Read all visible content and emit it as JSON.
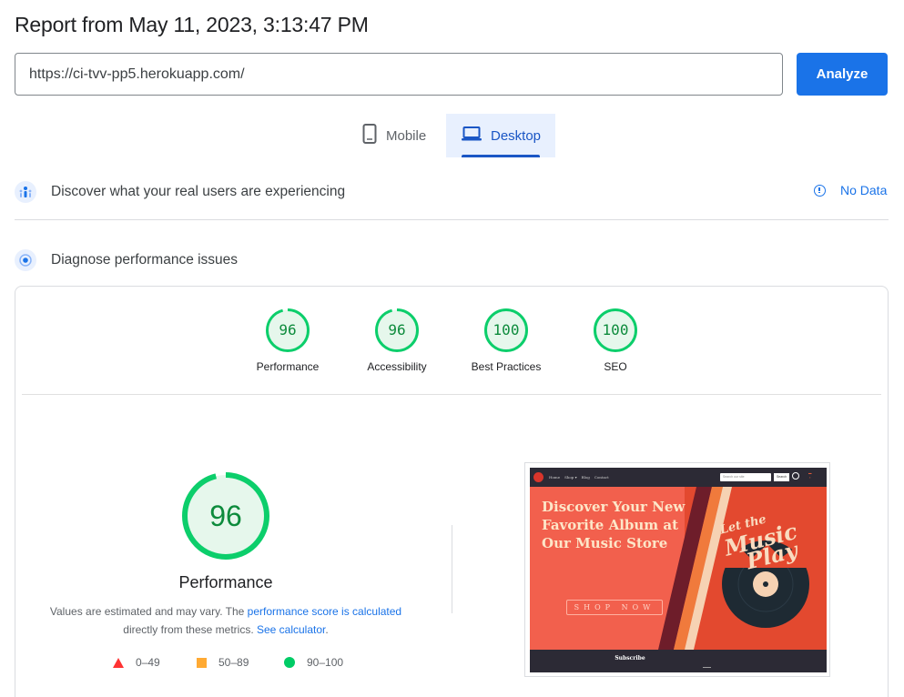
{
  "report": {
    "title": "Report from May 11, 2023, 3:13:47 PM"
  },
  "url_bar": {
    "value": "https://ci-tvv-pp5.herokuapp.com/",
    "button_label": "Analyze"
  },
  "tabs": [
    {
      "label": "Mobile",
      "icon": "smartphone-icon",
      "selected": false
    },
    {
      "label": "Desktop",
      "icon": "laptop-icon",
      "selected": true
    }
  ],
  "real_users": {
    "title": "Discover what your real users are experiencing",
    "status": "No Data"
  },
  "diagnose": {
    "title": "Diagnose performance issues"
  },
  "categories": [
    {
      "label": "Performance",
      "score": "96"
    },
    {
      "label": "Accessibility",
      "score": "96"
    },
    {
      "label": "Best Practices",
      "score": "100"
    },
    {
      "label": "SEO",
      "score": "100"
    }
  ],
  "performance": {
    "score": "96",
    "label": "Performance",
    "desc_prefix": "Values are estimated and may vary. The ",
    "desc_link": "performance score is calculated",
    "desc_middle": " directly from these metrics. ",
    "desc_link2": "See calculator",
    "desc_suffix": "."
  },
  "legend": [
    {
      "range": "0–49",
      "shape": "triangle",
      "color": "#ff3333"
    },
    {
      "range": "50–89",
      "shape": "square",
      "color": "#ffaa33"
    },
    {
      "range": "90–100",
      "shape": "circle",
      "color": "#00cc66"
    }
  ],
  "screenshot": {
    "nav_links": [
      "Home",
      "Shop ▾",
      "Blog",
      "Contact"
    ],
    "search_placeholder": "Search our site",
    "search_button": "Search",
    "headline": "Discover Your New Favorite Album at Our Music Store",
    "cta": "SHOP NOW",
    "art_text_1": "Let the",
    "art_text_2": "Music",
    "art_text_3": "Play",
    "footer_title": "Subscribe"
  },
  "colors": {
    "accent": "#1a73e8",
    "pass": "#0cce6b",
    "pass_text": "#0d8b3c"
  }
}
